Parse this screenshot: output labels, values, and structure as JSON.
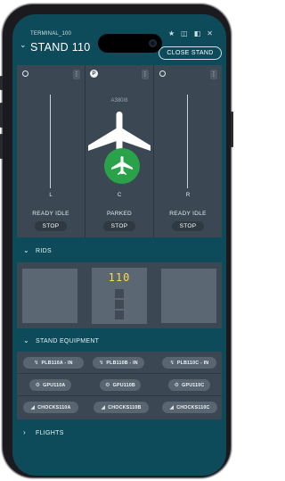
{
  "header": {
    "terminal": "TERMINAL_100",
    "title": "STAND 110",
    "close_label": "CLOSE STAND",
    "window_icons": [
      "pin-icon",
      "panel-icon",
      "split-icon",
      "close-icon"
    ]
  },
  "stands": [
    {
      "letter": "L",
      "status": "READY IDLE",
      "stop_label": "STOP",
      "indicator": "radio"
    },
    {
      "letter": "C",
      "status": "PARKED",
      "stop_label": "STOP",
      "indicator": "P",
      "aircraft": "A380/8"
    },
    {
      "letter": "R",
      "status": "READY IDLE",
      "stop_label": "STOP",
      "indicator": "radio"
    }
  ],
  "sections": {
    "rids": "RIDS",
    "equipment": "STAND EQUIPMENT",
    "flights": "FLIGHTS"
  },
  "rids": {
    "center_number": "110"
  },
  "equipment": {
    "rows": [
      [
        {
          "label": "PLB110A - IN",
          "icon": "bridge-icon"
        },
        {
          "label": "PLB110B - IN",
          "icon": "bridge-icon"
        },
        {
          "label": "PLB110C - IN",
          "icon": "bridge-icon"
        }
      ],
      [
        {
          "label": "GPU110A",
          "icon": "gpu-icon"
        },
        {
          "label": "GPU110B",
          "icon": "gpu-icon"
        },
        {
          "label": "GPU110C",
          "icon": "gpu-icon"
        }
      ],
      [
        {
          "label": "CHOCKS110A",
          "icon": "chocks-icon"
        },
        {
          "label": "CHOCKS110B",
          "icon": "chocks-icon"
        },
        {
          "label": "CHOCKS110C",
          "icon": "chocks-icon"
        }
      ]
    ]
  },
  "colors": {
    "background": "#0d4a5a",
    "panel": "#3b4752",
    "parked": "#2aa24a",
    "rid_number": "#ffd84a"
  }
}
